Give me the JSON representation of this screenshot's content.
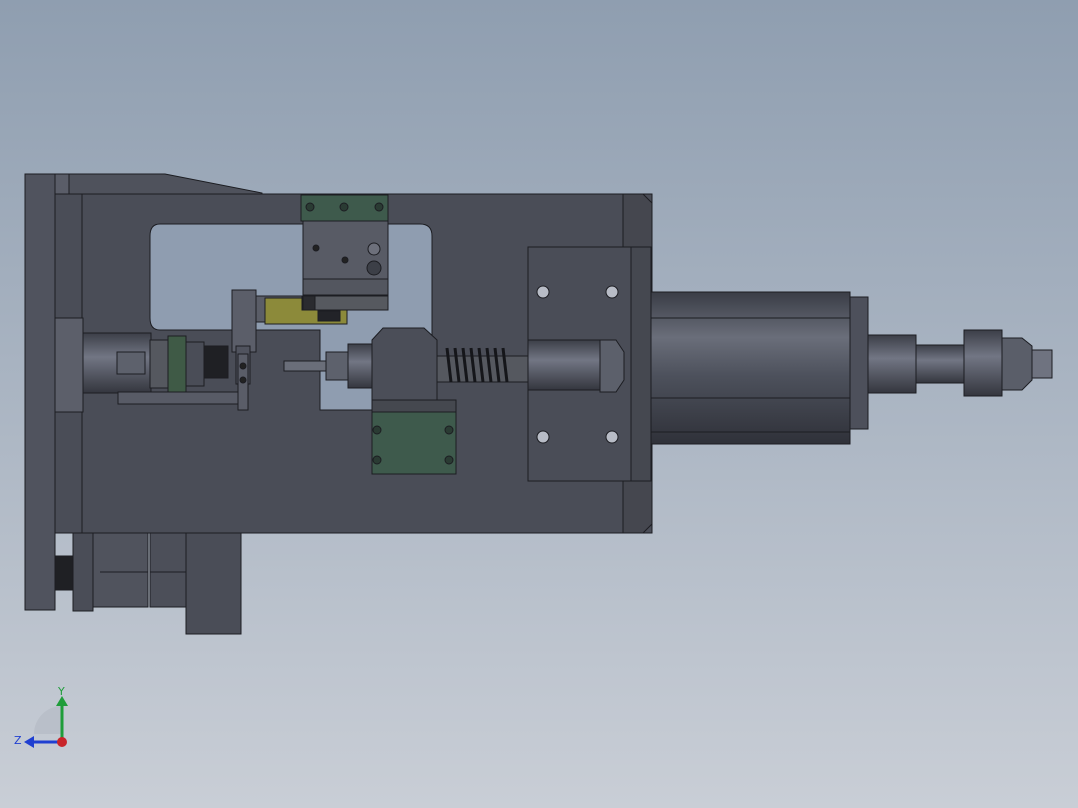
{
  "viewport": {
    "title": "",
    "background_top": "#8f9eb0",
    "background_bottom": "#c9ced6"
  },
  "model": {
    "body_color": "#4a4d57",
    "edge_color": "#1c1d22",
    "accent_green": "#3e5a4c",
    "accent_yellow": "#8c8a3a"
  },
  "triad": {
    "y_label": "Y",
    "z_label": "Z",
    "y_color": "#1f9d3a",
    "z_color": "#1f3fd1",
    "x_color": "#c8242a"
  }
}
